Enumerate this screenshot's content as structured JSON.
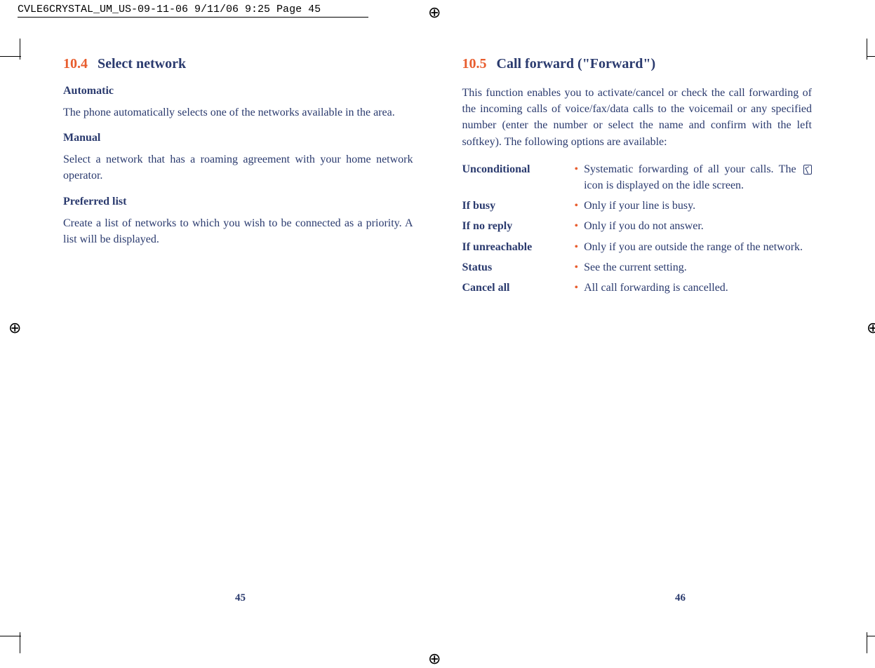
{
  "header": {
    "banner": "CVLE6CRYSTAL_UM_US-09-11-06  9/11/06  9:25  Page 45"
  },
  "left_page": {
    "section_num": "10.4",
    "section_title": "Select network",
    "items": [
      {
        "heading": "Automatic",
        "text": "The phone automatically selects one of the networks available in the area."
      },
      {
        "heading": "Manual",
        "text": "Select a network that has a roaming agreement with your home network operator."
      },
      {
        "heading": "Preferred list",
        "text": "Create a list of networks to which you wish to be connected as a priority. A list will be displayed."
      }
    ],
    "page_number": "45"
  },
  "right_page": {
    "section_num": "10.5",
    "section_title": "Call forward (\"Forward\")",
    "intro": "This function enables you to activate/cancel or check the call forwarding of the incoming calls of voice/fax/data calls to the voicemail or any specified number (enter the number or select the name and confirm with the left softkey). The following options are available:",
    "options": [
      {
        "label": "Unconditional",
        "desc": "Systematic forwarding of all your calls. The",
        "desc2": "icon is displayed on the idle screen.",
        "has_icon": true
      },
      {
        "label": "If busy",
        "desc": "Only if your line is busy."
      },
      {
        "label": "If no reply",
        "desc": "Only if you do not answer."
      },
      {
        "label": "If unreachable",
        "desc": "Only if you are outside the range of the network."
      },
      {
        "label": "Status",
        "desc": "See the current setting."
      },
      {
        "label": "Cancel all",
        "desc": "All call forwarding is cancelled."
      }
    ],
    "page_number": "46"
  }
}
